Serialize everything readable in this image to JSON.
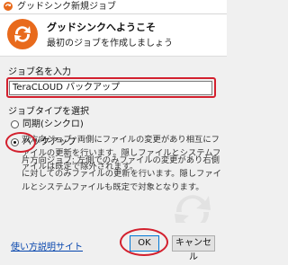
{
  "window": {
    "title": "グッドシンク新規ジョブ"
  },
  "header": {
    "heading": "グッドシンクへようこそ",
    "subheading": "最初のジョブを作成しましょう"
  },
  "job_name": {
    "label": "ジョブ名を入力",
    "value": "TeraCLOUD バックアップ"
  },
  "job_type": {
    "label": "ジョブタイプを選択",
    "options": [
      {
        "label": "同期(シンクロ)",
        "checked": false,
        "description": "双方向ジョブ: 両側にファイルの変更があり相互にファイルの更新を行います。隠しファイルとシステムファイルは既定で除外されます。"
      },
      {
        "label": "バックアップ",
        "checked": true,
        "description": "片方向ジョブ: 左側でのみファイルの変更があり右側に対してのみファイルの更新を行います。隠しファイルとシステムファイルも既定で対象となります。"
      }
    ]
  },
  "footer": {
    "help_link": "使い方説明サイト",
    "ok_label": "OK",
    "cancel_label": "キャンセル"
  },
  "colors": {
    "brand": "#e86a1c",
    "highlight": "#d3202e",
    "link": "#0645ad"
  },
  "icons": {
    "app": "goodsync-icon",
    "logo": "goodsync-logo",
    "watermark": "sync-arrows-watermark"
  }
}
